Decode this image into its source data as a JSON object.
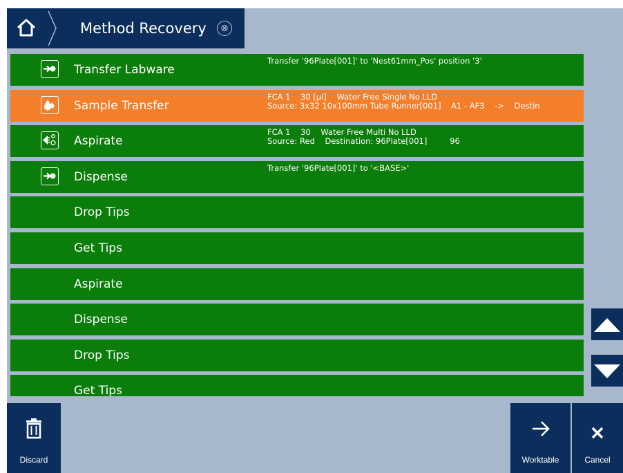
{
  "header": {
    "title": "Method Recovery",
    "close_symbol": "⊗"
  },
  "rows": [
    {
      "name": "Transfer Labware",
      "icon": "arrow-dot-icon",
      "details": [
        "Transfer '96Plate[001]' to 'Nest61mm_Pos' position '3'"
      ],
      "selected": false
    },
    {
      "name": "Sample Transfer",
      "icon": "drops-icon",
      "details": [
        "FCA 1    30 [µl]    Water Free Single No LLD",
        "Source: 3x32 10x100mm Tube Runner[001]    A1 - AF3    ->    Destin"
      ],
      "selected": true
    },
    {
      "name": "Aspirate",
      "icon": "aspirate-icon",
      "details": [
        "FCA 1    30    Water Free Multi No LLD",
        "Source: Red    Destination: 96Plate[001]         96"
      ],
      "selected": false
    },
    {
      "name": "Dispense",
      "icon": "arrow-dot-icon",
      "details": [
        "Transfer '96Plate[001]' to '<BASE>'"
      ],
      "selected": false
    },
    {
      "name": "Drop Tips",
      "icon": "",
      "details": [],
      "selected": false
    },
    {
      "name": "Get Tips",
      "icon": "",
      "details": [],
      "selected": false
    },
    {
      "name": "Aspirate",
      "icon": "",
      "details": [],
      "selected": false
    },
    {
      "name": "Dispense",
      "icon": "",
      "details": [],
      "selected": false
    },
    {
      "name": "Drop Tips",
      "icon": "",
      "details": [],
      "selected": false
    },
    {
      "name": "Get Tips",
      "icon": "",
      "details": [],
      "selected": false
    }
  ],
  "footer": {
    "discard_label": "Discard",
    "worktable_label": "Worktable",
    "cancel_label": "Cancel"
  },
  "colors": {
    "navy": "#0c2e5c",
    "row_green": "#0a7d0a",
    "row_selected": "#f47f2a",
    "background": "#a8b8cc"
  }
}
